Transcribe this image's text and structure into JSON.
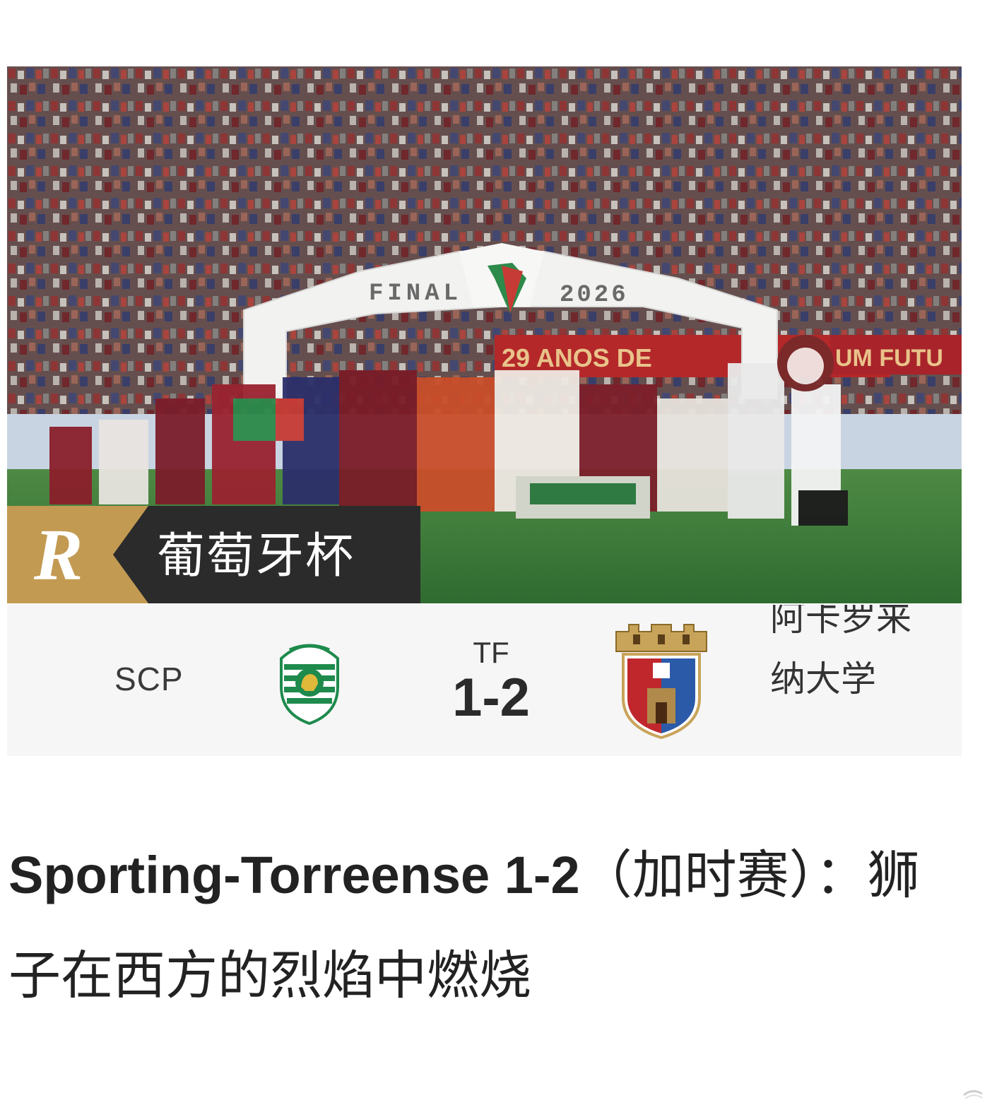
{
  "hero": {
    "arch_left_text": "FINAL",
    "arch_right_text": "2026",
    "banner_text": "29 ANOS DE",
    "banner_right_text": "UM FUTU",
    "competition_label": "葡萄牙杯",
    "logo_letter": "R",
    "colors": {
      "logo_bg": "#c39a52",
      "label_bg": "#2b2b2b",
      "pitch": "#3f7a3a",
      "crowd": "#7a5a58"
    }
  },
  "match": {
    "home_abbr": "SCP",
    "status": "TF",
    "score": "1-2",
    "away_name": "阿卡罗来纳大学",
    "home_crest_icon": "sporting-lion-crest",
    "away_crest_icon": "torreense-castle-crest",
    "colors": {
      "home_green": "#1e8a4c",
      "away_red": "#c0272d",
      "away_blue": "#2b5aa8",
      "away_gold": "#c8a45a"
    }
  },
  "article": {
    "headline_latin": "Sporting-Torreense 1-2",
    "headline_cjk": "（加时赛）：狮子在西方的烈焰中燃烧"
  }
}
